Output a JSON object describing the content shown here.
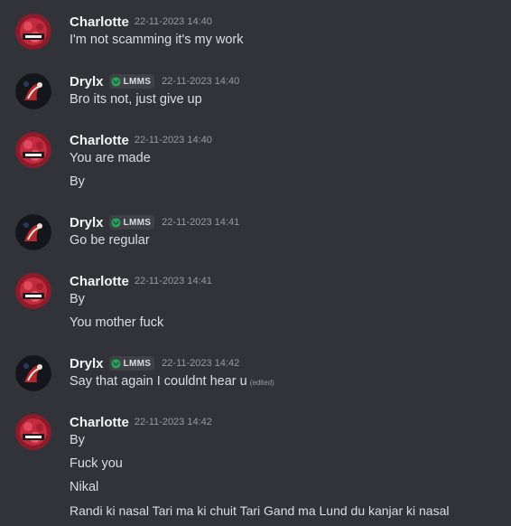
{
  "messages": [
    {
      "author": "Charlotte",
      "timestamp": "22-11-2023 14:40",
      "lines": [
        "I'm not scamming it's my work"
      ]
    },
    {
      "author": "Drylx",
      "tag": "LMMS",
      "timestamp": "22-11-2023 14:40",
      "lines": [
        "Bro its not, just give up"
      ]
    },
    {
      "author": "Charlotte",
      "timestamp": "22-11-2023 14:40",
      "lines": [
        "You are made",
        "By"
      ]
    },
    {
      "author": "Drylx",
      "tag": "LMMS",
      "timestamp": "22-11-2023 14:41",
      "lines": [
        "Go be regular"
      ]
    },
    {
      "author": "Charlotte",
      "timestamp": "22-11-2023 14:41",
      "lines": [
        "By",
        "You mother fuck"
      ]
    },
    {
      "author": "Drylx",
      "tag": "LMMS",
      "timestamp": "22-11-2023 14:42",
      "lines": [
        "Say that again I couldnt hear u"
      ],
      "edited": "(edited)"
    },
    {
      "author": "Charlotte",
      "timestamp": "22-11-2023 14:42",
      "lines": [
        "By",
        "Fuck you",
        "Nikal",
        "Randi ki nasal Tari ma ki chuit Tari Gand ma Lund du kanjar ki nasal"
      ]
    }
  ],
  "colors": {
    "background": "#313338",
    "username": "#f2f3f5",
    "text": "#dbdee1",
    "timestamp": "#949ba4",
    "tag_background": "#3f4147",
    "tag_icon": "#23a55a"
  },
  "icons": {
    "charlotte_avatar": "avatar-red-logo",
    "drylx_avatar": "avatar-dark-koi",
    "tag_icon": "shield-badge-icon"
  }
}
